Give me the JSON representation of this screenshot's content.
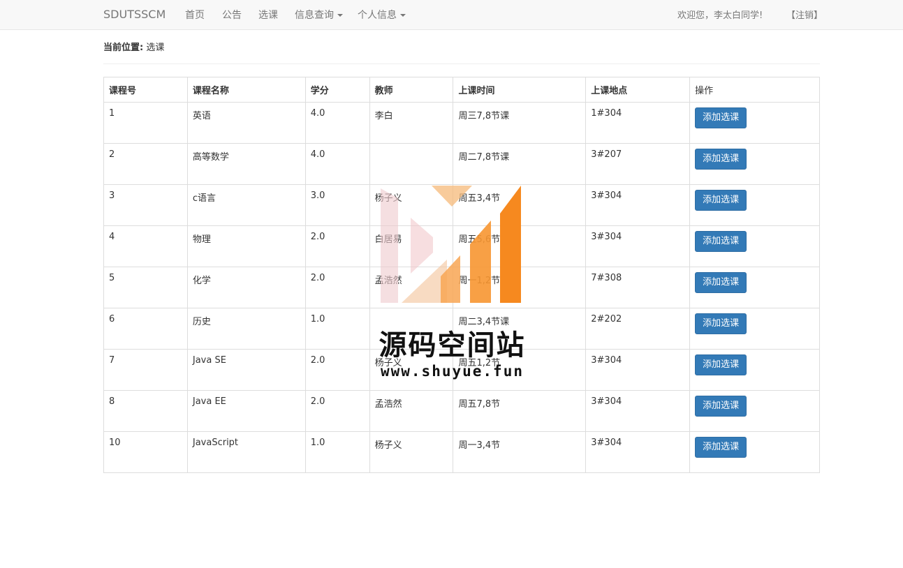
{
  "navbar": {
    "brand": "SDUTSSCM",
    "items": [
      {
        "label": "首页"
      },
      {
        "label": "公告"
      },
      {
        "label": "选课"
      },
      {
        "label": "信息查询"
      },
      {
        "label": "个人信息"
      }
    ],
    "welcome": "欢迎您，李太白同学!",
    "logout": "【注销】"
  },
  "location": {
    "label": "当前位置:",
    "value": "选课"
  },
  "table": {
    "headers": [
      "课程号",
      "课程名称",
      "学分",
      "教师",
      "上课时间",
      "上课地点",
      "操作"
    ],
    "action_label": "添加选课",
    "rows": [
      [
        "1",
        "英语",
        "4.0",
        "李白",
        "周三7,8节课",
        "1#304"
      ],
      [
        "2",
        "高等数学",
        "4.0",
        "",
        "周二7,8节课",
        "3#207"
      ],
      [
        "3",
        "c语言",
        "3.0",
        "杨子义",
        "周五3,4节",
        "3#304"
      ],
      [
        "4",
        "物理",
        "2.0",
        "白居易",
        "周五5,6节",
        "3#304"
      ],
      [
        "5",
        "化学",
        "2.0",
        "孟浩然",
        "周一1,2节",
        "7#308"
      ],
      [
        "6",
        "历史",
        "1.0",
        "",
        "周二3,4节课",
        "2#202"
      ],
      [
        "7",
        "Java SE",
        "2.0",
        "杨子义",
        "周五1,2节",
        "3#304"
      ],
      [
        "8",
        "Java EE",
        "2.0",
        "孟浩然",
        "周五7,8节",
        "3#304"
      ],
      [
        "10",
        "JavaScript",
        "1.0",
        "杨子义",
        "周一3,4节",
        "3#304"
      ]
    ]
  },
  "watermark": {
    "title": "源码空间站",
    "url": "www.shuyue.fun"
  },
  "colors": {
    "primary": "#337ab7",
    "navbar_bg": "#f8f8f8",
    "watermark_orange": "#f6891f"
  }
}
